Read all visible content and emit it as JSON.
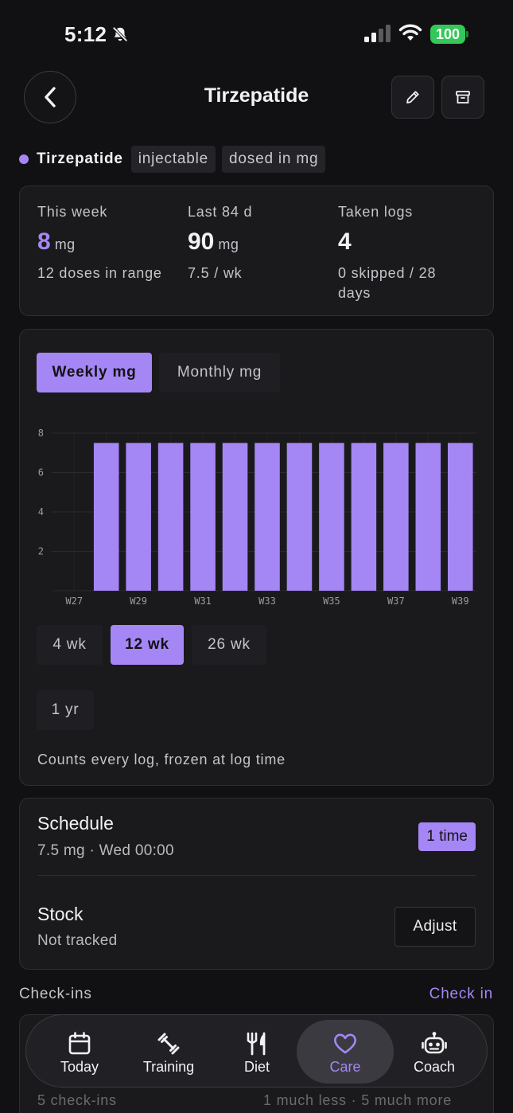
{
  "status_bar": {
    "time": "5:12",
    "battery": "100"
  },
  "header": {
    "title": "Tirzepatide"
  },
  "tags": {
    "name": "Tirzepatide",
    "items": [
      "injectable",
      "dosed in mg"
    ]
  },
  "stats": [
    {
      "label": "This week",
      "value": "8",
      "unit": "mg",
      "sub": "12 doses in range"
    },
    {
      "label": "Last 84 d",
      "value": "90",
      "unit": "mg",
      "sub": "7.5 / wk"
    },
    {
      "label": "Taken logs",
      "value": "4",
      "unit": "",
      "sub": "0 skipped / 28 days"
    }
  ],
  "chart_toggle": {
    "weekly": "Weekly mg",
    "monthly": "Monthly mg",
    "selected": "weekly"
  },
  "chart_data": {
    "type": "bar",
    "categories": [
      "W27",
      "W28",
      "W29",
      "W30",
      "W31",
      "W32",
      "W33",
      "W34",
      "W35",
      "W36",
      "W37",
      "W38",
      "W39"
    ],
    "x_tick_labels": [
      "W27",
      "W29",
      "W31",
      "W33",
      "W35",
      "W37",
      "W39"
    ],
    "values": [
      0,
      7.5,
      7.5,
      7.5,
      7.5,
      7.5,
      7.5,
      7.5,
      7.5,
      7.5,
      7.5,
      7.5,
      7.5
    ],
    "y_ticks": [
      "2",
      "4",
      "6",
      "8"
    ],
    "ylim": [
      0,
      8
    ],
    "grid": true,
    "bar_color": "#a586f5",
    "title": "",
    "xlabel": "",
    "ylabel": ""
  },
  "ranges": {
    "items": [
      "4 wk",
      "12 wk",
      "26 wk",
      "1 yr"
    ],
    "selected": "12 wk"
  },
  "chart_note": "Counts every log, frozen at log time",
  "schedule": {
    "title": "Schedule",
    "detail": "7.5 mg · Wed 00:00",
    "badge": "1 time"
  },
  "stock": {
    "title": "Stock",
    "detail": "Not tracked",
    "button": "Adjust"
  },
  "checkins": {
    "title": "Check-ins",
    "action": "Check in",
    "count_text": "5 check-ins",
    "scale_text": "1 much less · 5 much more"
  },
  "tabs": [
    {
      "label": "Today",
      "icon": "calendar-icon"
    },
    {
      "label": "Training",
      "icon": "dumbbell-icon"
    },
    {
      "label": "Diet",
      "icon": "fork-knife-icon"
    },
    {
      "label": "Care",
      "icon": "heart-icon",
      "active": true
    },
    {
      "label": "Coach",
      "icon": "robot-icon"
    }
  ],
  "colors": {
    "accent": "#a586f5",
    "background": "#111113",
    "card": "#1a1a1d",
    "battery": "#34c759"
  }
}
